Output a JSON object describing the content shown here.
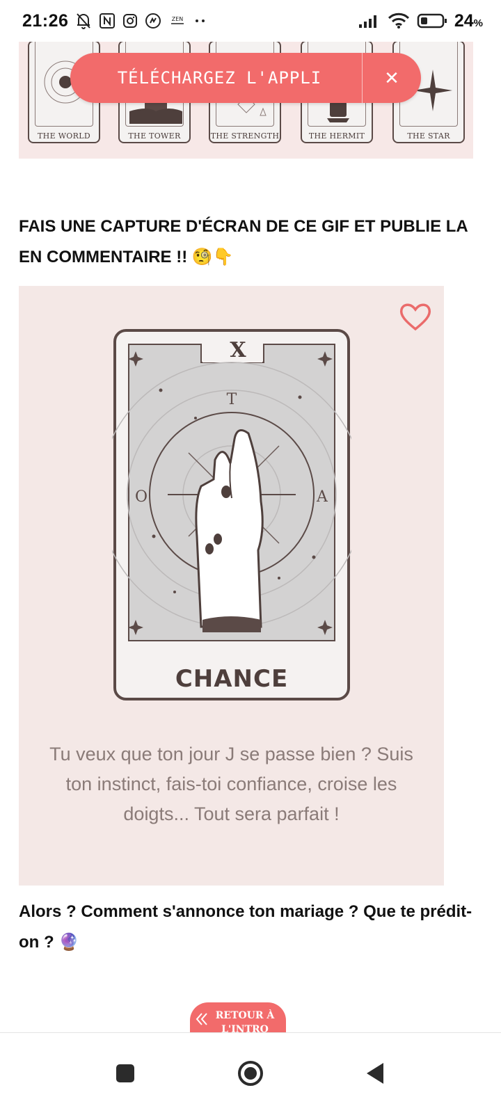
{
  "status_bar": {
    "time": "21:26",
    "battery_percent": "24",
    "battery_suffix": "%",
    "left_icons": [
      "notifications-off-icon",
      "nfc-icon",
      "instagram-icon",
      "activity-icon",
      "zen-icon",
      "more-dots-icon"
    ],
    "right_icons": [
      "signal-icon",
      "wifi-icon",
      "battery-icon"
    ]
  },
  "tarot_strip": {
    "cards": [
      "THE WORLD",
      "THE TOWER",
      "THE STRENGTH",
      "THE HERMIT",
      "THE STAR"
    ]
  },
  "app_banner": {
    "cta_label": "TÉLÉCHARGEZ L'APPLI",
    "close_label": "✕",
    "color": "#f26b6b"
  },
  "article": {
    "headline": "FAIS UNE CAPTURE D'ÉCRAN DE CE GIF ET PUBLIE LA EN COMMENTAIRE !! 🧐👇",
    "image": {
      "card_numeral": "X",
      "card_name": "CHANCE",
      "caption": "Tu veux que ton jour J se passe bien ? Suis ton instinct, fais-toi confiance, croise les doigts... Tout sera parfait !",
      "background_color": "#f4e8e6"
    },
    "question": "Alors ? Comment s'annonce ton mariage ? Que te prédit-on ? 🔮"
  },
  "retour_button": {
    "label": "RETOUR À L'INTRO",
    "icon": "double-chevron-left-icon"
  },
  "nav_bar": {
    "buttons": [
      "recents-square-icon",
      "home-circle-icon",
      "back-triangle-icon"
    ]
  }
}
